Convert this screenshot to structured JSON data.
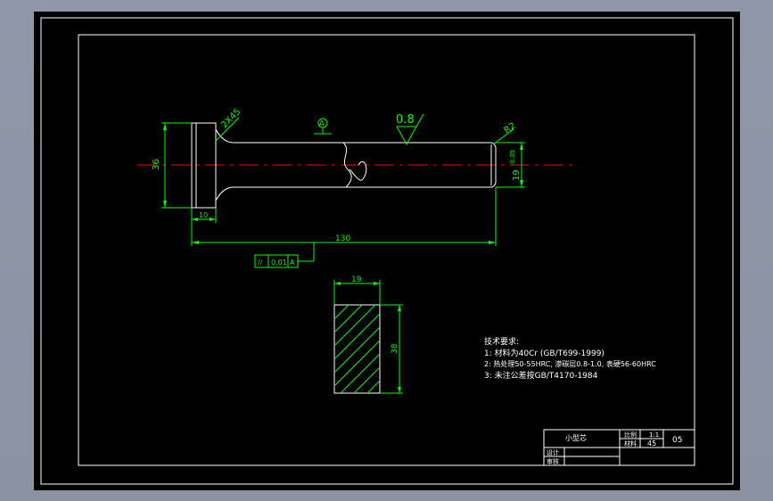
{
  "drawing": {
    "colors": {
      "background": "#000000",
      "frame": "#ffffff",
      "dimension": "#00ff00",
      "centerline": "#ff0000",
      "text": "#ffffff"
    },
    "labels": {
      "chamfer": "2X45",
      "datum": "A",
      "roughness": "0.8",
      "radius": "R2",
      "head_dia": "36",
      "shank_dia": "19",
      "shank_tol": "-0.05",
      "head_len": "10",
      "total_len": "130",
      "parallel_symbol": "//",
      "parallel_tol": "0.01",
      "parallel_datum": "A",
      "blank_w": "19",
      "blank_h": "38"
    },
    "tech_requirements": {
      "title": "技术要求:",
      "items": [
        "1: 材料为40Cr (GB/T699-1999)",
        "2: 热处理50-55HRC, 渗碳层0.8-1.0, 表硬56-60HRC",
        "3: 未注公差按GB/T4170-1984"
      ]
    },
    "title_block": {
      "part_name": "小型芯",
      "scale_label": "比例",
      "scale_value": "1:1",
      "material_label": "材料",
      "material_value": "45",
      "drawing_no": "05",
      "designer_label": "设计",
      "reviewer_label": "审核"
    }
  }
}
